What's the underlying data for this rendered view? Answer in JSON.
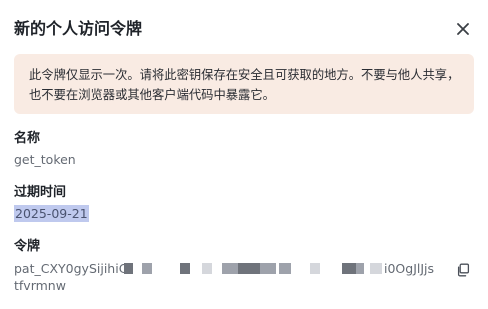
{
  "dialog": {
    "title": "新的个人访问令牌",
    "close_icon": "close-icon"
  },
  "warning": {
    "text": "此令牌仅显示一次。请将此密钥保存在安全且可获取的地方。不要与他人共享，也不要在浏览器或其他客户端代码中暴露它。"
  },
  "fields": {
    "name": {
      "label": "名称",
      "value": "get_token"
    },
    "expiry": {
      "label": "过期时间",
      "value": "2025-09-21"
    },
    "token": {
      "label": "令牌",
      "value_start": "pat_CXY0gySijihiC",
      "value_end": "i0OgJlJjs",
      "value_wrap": "tfvrmnw",
      "redacted": true,
      "copy_icon": "copy-icon"
    }
  },
  "colors": {
    "warning_bg": "#f9ebe3",
    "selection_bg": "#bfc9ee",
    "redaction": "#9ea2ab"
  }
}
